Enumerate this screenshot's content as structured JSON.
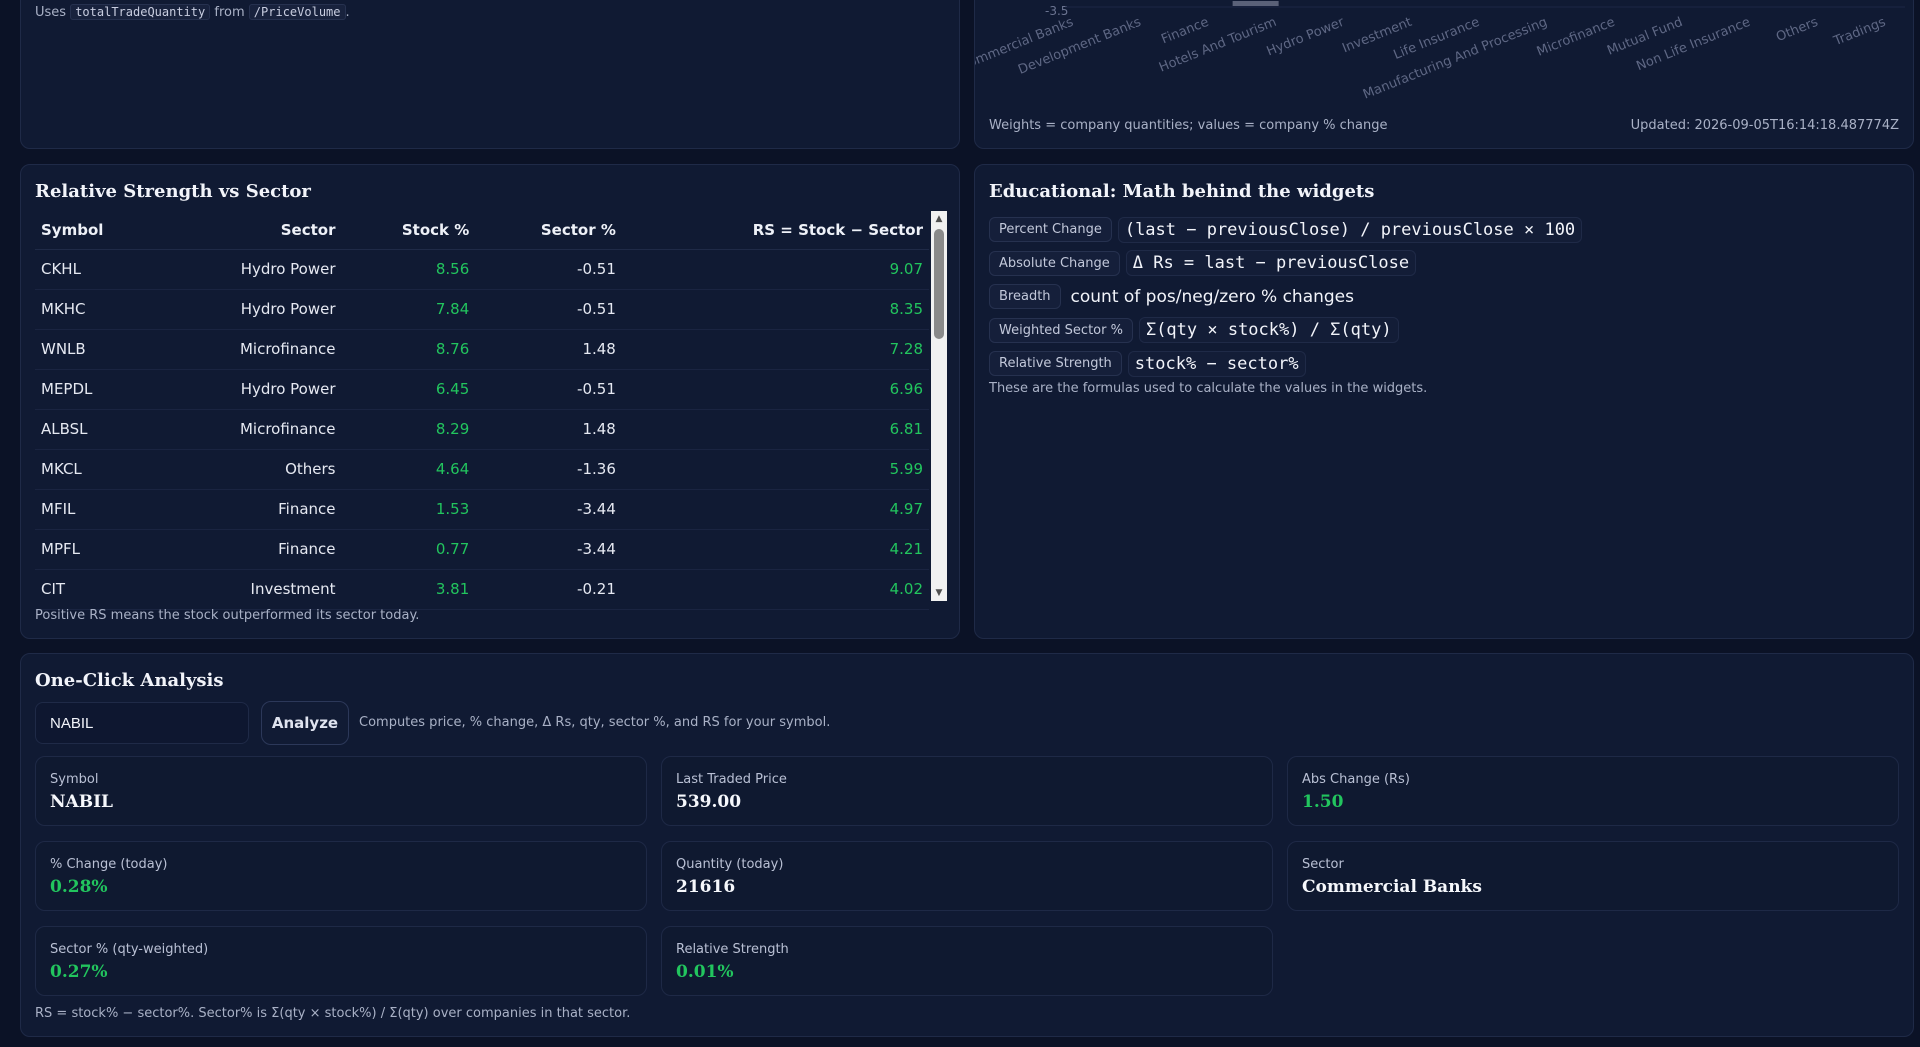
{
  "uses_card": {
    "prefix": "Uses",
    "code1": "totalTradeQuantity",
    "mid": "from",
    "code2": "/PriceVolume",
    "suffix": "."
  },
  "sector_chart": {
    "footer_left": "Weights = company quantities; values = company % change",
    "footer_right": "Updated: 2026-09-05T16:14:18.487774Z"
  },
  "chart_data": {
    "type": "bar",
    "title": "",
    "xlabel": "",
    "ylabel": "",
    "visible_tick": "-3.5",
    "categories": [
      "Commercial Banks",
      "Development Banks",
      "Finance",
      "Hotels And Tourism",
      "Hydro Power",
      "Investment",
      "Life Insurance",
      "Manufacturing And Processing",
      "Microfinance",
      "Mutual Fund",
      "Non Life Insurance",
      "Others",
      "Tradings"
    ],
    "visible_bar_category": "Finance",
    "visible_bar_value": -3.44
  },
  "relative_strength": {
    "title": "Relative Strength vs Sector",
    "headers": [
      "Symbol",
      "Sector",
      "Stock %",
      "Sector %",
      "RS = Stock − Sector"
    ],
    "rows": [
      [
        "CKHL",
        "Hydro Power",
        "8.56",
        "-0.51",
        "9.07"
      ],
      [
        "MKHC",
        "Hydro Power",
        "7.84",
        "-0.51",
        "8.35"
      ],
      [
        "WNLB",
        "Microfinance",
        "8.76",
        "1.48",
        "7.28"
      ],
      [
        "MEPDL",
        "Hydro Power",
        "6.45",
        "-0.51",
        "6.96"
      ],
      [
        "ALBSL",
        "Microfinance",
        "8.29",
        "1.48",
        "6.81"
      ],
      [
        "MKCL",
        "Others",
        "4.64",
        "-1.36",
        "5.99"
      ],
      [
        "MFIL",
        "Finance",
        "1.53",
        "-3.44",
        "4.97"
      ],
      [
        "MPFL",
        "Finance",
        "0.77",
        "-3.44",
        "4.21"
      ],
      [
        "CIT",
        "Investment",
        "3.81",
        "-0.21",
        "4.02"
      ]
    ],
    "note": "Positive RS means the stock outperformed its sector today."
  },
  "educational": {
    "title": "Educational: Math behind the widgets",
    "formulas": [
      {
        "label": "Percent Change",
        "expr": "(last − previousClose) / previousClose × 100"
      },
      {
        "label": "Absolute Change",
        "expr": "Δ Rs = last − previousClose"
      },
      {
        "label": "Breadth",
        "expr": "count of pos/neg/zero % changes"
      },
      {
        "label": "Weighted Sector %",
        "expr": "Σ(qty × stock%) / Σ(qty)"
      },
      {
        "label": "Relative Strength",
        "expr": "stock% − sector%"
      }
    ],
    "note": "These are the formulas used to calculate the values in the widgets."
  },
  "analysis": {
    "title": "One-Click Analysis",
    "input_value": "NABIL",
    "button_label": "Analyze",
    "hint": "Computes price, % change, Δ Rs, qty, sector %, and RS for your symbol.",
    "stats": [
      {
        "label": "Symbol",
        "value": "NABIL"
      },
      {
        "label": "Last Traded Price",
        "value": "539.00"
      },
      {
        "label": "Abs Change (Rs)",
        "value": "1.50"
      },
      {
        "label": "% Change (today)",
        "value": "0.28%"
      },
      {
        "label": "Quantity (today)",
        "value": "21616"
      },
      {
        "label": "Sector",
        "value": "Commercial Banks"
      },
      {
        "label": "Sector % (qty-weighted)",
        "value": "0.27%"
      },
      {
        "label": "Relative Strength",
        "value": "0.01%"
      }
    ],
    "note": "RS = stock% − sector%. Sector% is Σ(qty × stock%) / Σ(qty) over companies in that sector."
  },
  "colors": {
    "background": "#0b1226",
    "card": "#101a33",
    "positive": "#22c55e",
    "muted_text": "#a9b1c6"
  }
}
